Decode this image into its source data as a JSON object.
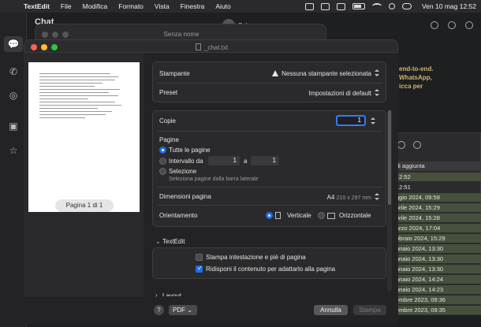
{
  "menubar": {
    "items": [
      "TextEdit",
      "File",
      "Modifica",
      "Formato",
      "Vista",
      "Finestra",
      "Aiuto"
    ],
    "clock": "Ven 10 mag  12:52"
  },
  "chat_app": {
    "header": "Chat",
    "contact": "Salva",
    "e2e_note": "end-to-end.\nWhatsApp,\nicca per",
    "list_header": "di aggiunta",
    "list_items": [
      "12:52",
      "12:51",
      "ggio 2024, 09:58",
      "prile 2024, 15:29",
      "prile 2024, 15:28",
      "arzo 2024, 17:04",
      "bbraio 2024, 15:29",
      "nnaio 2024, 13:30",
      "nnaio 2024, 13:30",
      "nnaio 2024, 13:30",
      "nnaio 2024, 14:24",
      "nnaio 2024, 14:23",
      "embre 2023, 09:36",
      "embre 2023, 09:35"
    ]
  },
  "windows": {
    "back_title": "Senza nome",
    "main_title": "_chat.txt"
  },
  "print": {
    "printer_label": "Stampante",
    "printer_value": "Nessuna stampante selezionata",
    "preset_label": "Preset",
    "preset_value": "Impostazioni di default",
    "copies_label": "Copie",
    "copies_value": "1",
    "pages_label": "Pagine",
    "all_pages": "Tutte le pagine",
    "range_label": "Intervallo da",
    "range_from": "1",
    "range_to_label": "a",
    "range_to": "1",
    "selection_label": "Selezione",
    "selection_hint": "Seleziona pagine dalla barra laterale",
    "paper_label": "Dimensioni pagina",
    "paper_value": "A4",
    "paper_dims": "210 x 297 mm",
    "orientation_label": "Orientamento",
    "orient_portrait": "Verticale",
    "orient_landscape": "Orizzontale",
    "textedit_section": "TextEdit",
    "opt_header_footer": "Stampa intestazione e piè di pagina",
    "opt_rewrap": "Ridisponi il contenuto per adattarlo alla pagina",
    "layout_section": "Layout",
    "page_indicator": "Pagina 1 di 1",
    "help": "?",
    "pdf": "PDF",
    "cancel": "Annulla",
    "print_btn": "Stampa"
  }
}
